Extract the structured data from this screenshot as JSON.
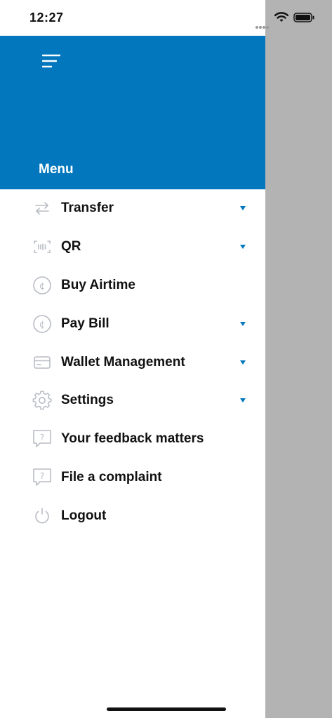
{
  "status_bar": {
    "time": "12:27",
    "icons": [
      "signal-icon",
      "wifi-icon",
      "battery-icon"
    ]
  },
  "header": {
    "title": "Menu",
    "menu_icon": "hamburger-icon",
    "background": "#0277bd"
  },
  "menu": {
    "accent_color": "#0277bd",
    "items": [
      {
        "label": "Transfer",
        "icon": "transfer-icon",
        "expandable": true
      },
      {
        "label": "QR",
        "icon": "qr-icon",
        "expandable": true
      },
      {
        "label": "Buy Airtime",
        "icon": "cedi-icon",
        "expandable": false
      },
      {
        "label": "Pay Bill",
        "icon": "cedi-icon",
        "expandable": true
      },
      {
        "label": "Wallet Management",
        "icon": "card-icon",
        "expandable": true
      },
      {
        "label": "Settings",
        "icon": "gear-icon",
        "expandable": true
      },
      {
        "label": "Your feedback matters",
        "icon": "feedback-icon",
        "expandable": false
      },
      {
        "label": "File a complaint",
        "icon": "feedback-icon",
        "expandable": false
      },
      {
        "label": "Logout",
        "icon": "power-icon",
        "expandable": false
      }
    ]
  }
}
